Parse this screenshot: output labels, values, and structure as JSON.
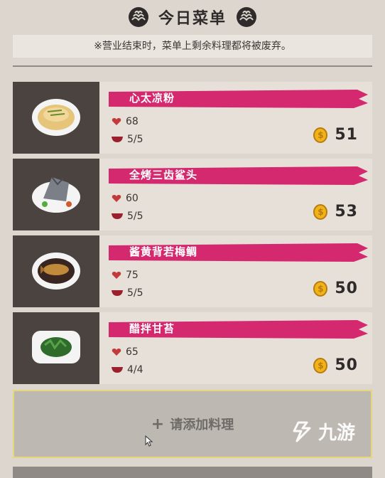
{
  "header": {
    "title": "今日菜单"
  },
  "notice": {
    "text": "※营业结束时，菜单上剩余料理都将被废弃。"
  },
  "dishes": [
    {
      "name": "心太凉粉",
      "popularity": "68",
      "stock": "5/5",
      "price": "51"
    },
    {
      "name": "全烤三齿鲨头",
      "popularity": "60",
      "stock": "5/5",
      "price": "53"
    },
    {
      "name": "酱黄背若梅鲷",
      "popularity": "75",
      "stock": "5/5",
      "price": "50"
    },
    {
      "name": "醋拌甘苔",
      "popularity": "65",
      "stock": "4/4",
      "price": "50"
    }
  ],
  "add_slot": {
    "label": "请添加料理",
    "icon": "plus-icon"
  },
  "watermark": {
    "text": "九游"
  },
  "colors": {
    "accent_brush": "#d4286f",
    "coin": "#f0b418",
    "panel": "#e6e0d9"
  }
}
